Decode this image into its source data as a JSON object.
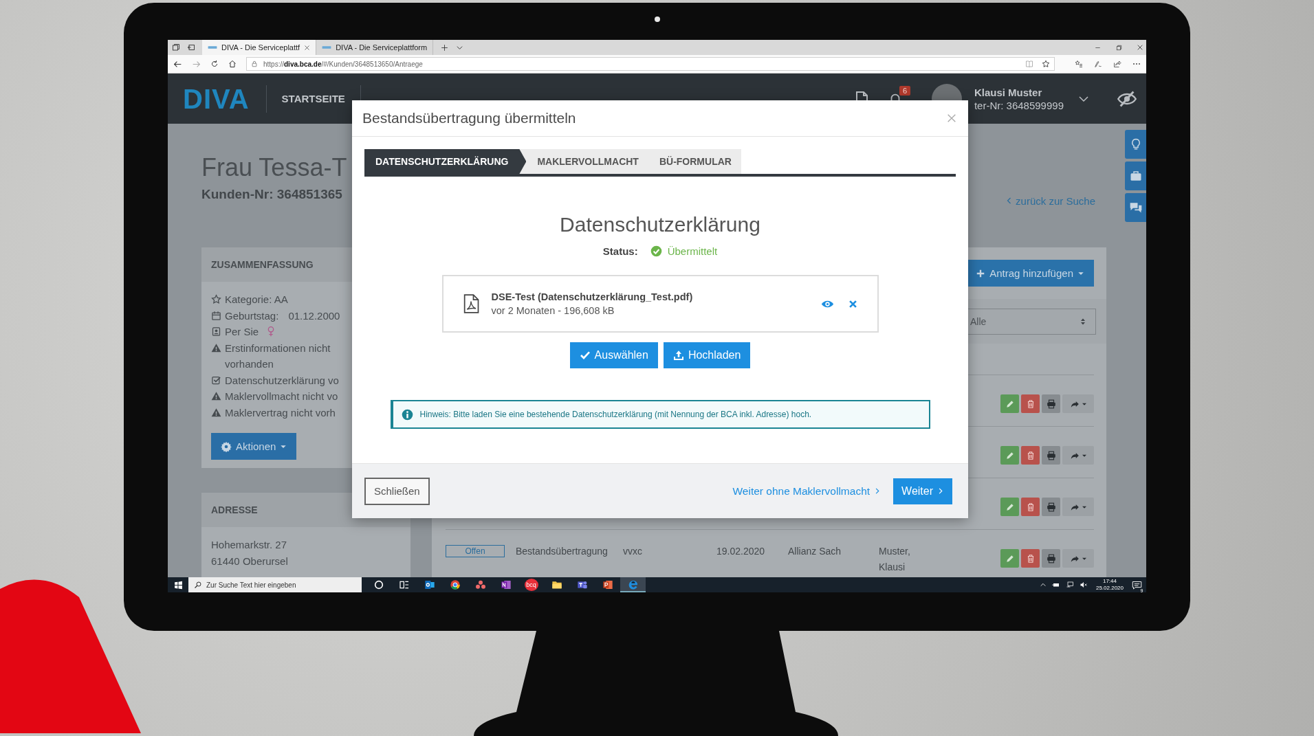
{
  "browser": {
    "tabs": [
      {
        "title": "DIVA - Die Serviceplattf",
        "selected": true
      },
      {
        "title": "DIVA - Die Serviceplattform",
        "selected": false
      }
    ],
    "url": "https://**diva.bca.de**/#/Kunden/3648513650/Antraege"
  },
  "navbar": {
    "logo": "DIVA",
    "items": [
      {
        "label": "STARTSEITE",
        "selected": false
      }
    ],
    "notification_count": "6",
    "user": {
      "name": "Klausi Muster",
      "number": "ter-Nr: 3648599999"
    }
  },
  "customer": {
    "title": "Frau Tessa-T",
    "number": "Kunden-Nr: 364851365",
    "back_link": "zurück zur Suche"
  },
  "summary": {
    "heading": "ZUSAMMENFASSUNG",
    "items": [
      {
        "kind": "star",
        "text": "Kategorie: AA"
      },
      {
        "kind": "calendar",
        "text": "Geburtstag:",
        "value": "01.12.2000"
      },
      {
        "kind": "salutation",
        "text": "Per Sie"
      },
      {
        "kind": "warning",
        "text": "Erstinformationen nicht vorhanden"
      },
      {
        "kind": "check",
        "text": "Datenschutzerklärung vo"
      },
      {
        "kind": "warning",
        "text": "Maklervollmacht nicht vo"
      },
      {
        "kind": "warning",
        "text": "Maklervertrag nicht vorh"
      }
    ],
    "actions_button": "Aktionen"
  },
  "address": {
    "heading": "ADRESSE",
    "lines": [
      "Hohemarkstr. 27",
      "61440 Oberursel"
    ]
  },
  "applications": {
    "add_button": "Antrag hinzufügen",
    "filter": "Alle",
    "rows": [
      {
        "kind": "covered"
      },
      {
        "kind": "covered"
      },
      {
        "kind": "covered"
      },
      {
        "kind": "entry",
        "status": "Offen",
        "type": "Bestandsübertragung",
        "column_3": "vvxc",
        "date": "19.02.2020",
        "company": "Allianz Sach",
        "broker": "Muster, Klausi"
      }
    ]
  },
  "modal": {
    "title": "Bestandsübertragung übermitteln",
    "steps": [
      {
        "label": "DATENSCHUTZERKLÄRUNG",
        "selected": true
      },
      {
        "label": "MAKLERVOLLMACHT",
        "selected": false
      },
      {
        "label": "BÜ-FORMULAR",
        "selected": false
      }
    ],
    "heading": "Datenschutzerklärung",
    "status_label": "Status:",
    "status": "Übermittelt",
    "file": {
      "name": "DSE-Test (Datenschutzerklärung_Test.pdf)",
      "meta": "vor 2 Monaten - 196,608 kB"
    },
    "buttons": [
      {
        "label": "Auswählen",
        "kind": "select"
      },
      {
        "label": "Hochladen",
        "kind": "upload"
      }
    ],
    "hint": "Hinweis: Bitte laden Sie eine bestehende Datenschutzerklärung (mit Nennung der BCA inkl. Adresse) hoch.",
    "close_button": "Schließen",
    "skip_link": "Weiter ohne Maklervollmacht",
    "next_button": "Weiter"
  },
  "taskbar": {
    "search_placeholder": "Zur Suche Text hier eingeben",
    "apps": [
      {
        "kind": "cortana",
        "selected": false
      },
      {
        "kind": "task-view",
        "selected": false
      },
      {
        "kind": "mail",
        "selected": false
      },
      {
        "kind": "browser",
        "selected": false
      },
      {
        "kind": "dots",
        "selected": false
      },
      {
        "kind": "notebook",
        "selected": false
      },
      {
        "kind": "text",
        "label": "bcq",
        "selected": false
      },
      {
        "kind": "folder",
        "selected": false
      },
      {
        "kind": "team",
        "selected": false
      },
      {
        "kind": "slides",
        "selected": false
      },
      {
        "kind": "edge",
        "selected": true
      }
    ],
    "time": "17:44",
    "date": "25.02.2020",
    "notifications": "9"
  }
}
